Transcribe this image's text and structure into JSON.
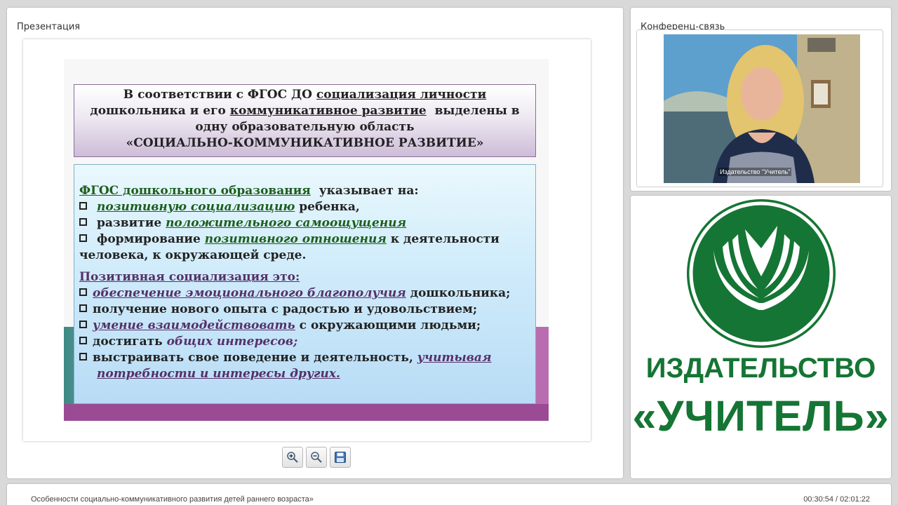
{
  "presentation": {
    "title": "Презентация",
    "slide": {
      "top_box": {
        "l1_a": "В соответствии с ФГОС ДО ",
        "l1_b": "социализация личности",
        "l2_a": "дошкольника и его ",
        "l2_b": "коммуникативное развитие",
        "l2_c": "  выделены в",
        "l3": "одну образовательную область",
        "l4": "«СОЦИАЛЬНО-КОММУНИКАТИВНОЕ РАЗВИТИЕ»"
      },
      "main_box": {
        "h1_a": "ФГОС дошкольного образования",
        "h1_b": "  указывает на:",
        "i1_a": "позитивную социализацию",
        "i1_b": " ребенка,",
        "i2_a": "развитие ",
        "i2_b": "положительного самоощущения",
        "i3_a": "формирование ",
        "i3_b": "позитивного отношения",
        "i3_c": " к деятельности",
        "i3_d": "человека, к окружающей среде.",
        "h2": "Позитивная социализация это:",
        "j1_a": "обеспечение эмоционального благополучия",
        "j1_b": " дошкольника;",
        "j2": "получение нового опыта с радостью и удовольствием;",
        "j3_a": "умение взаимодействовать",
        "j3_b": " с окружающими людьми;",
        "j4_a": "достигать ",
        "j4_b": "общих интересов;",
        "j5_a": "выстраивать свое поведение и деятельность, ",
        "j5_b": "учитывая",
        "j5_c": "потребности и интересы других."
      }
    }
  },
  "conference": {
    "title": "Конференц-связь",
    "video_caption": "Издательство \"Учитель\""
  },
  "logo": {
    "line1": "ИЗДАТЕЛЬСТВО",
    "line2": "«УЧИТЕЛЬ»",
    "color": "#157534"
  },
  "toolbar": {
    "zoom_in_icon": "zoom-in-icon",
    "zoom_out_icon": "zoom-out-icon",
    "save_icon": "floppy-disk-icon"
  },
  "footer": {
    "title": "Особенности социально-коммуникативного развития детей раннего возраста»",
    "time": "00:30:54 / 02:01:22"
  }
}
